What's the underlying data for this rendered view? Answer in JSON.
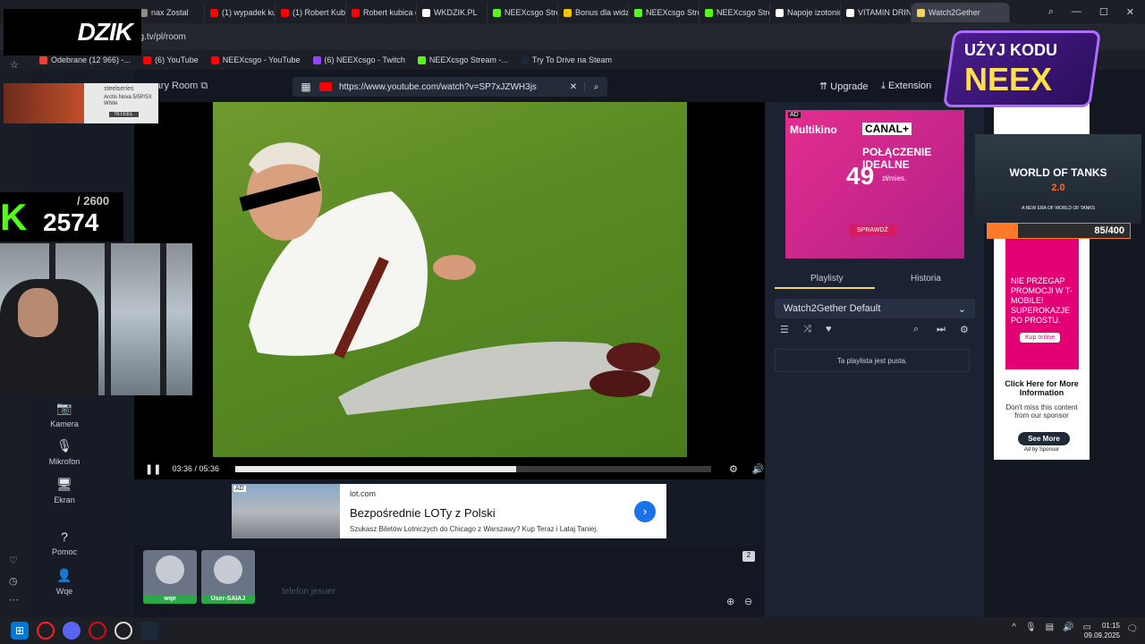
{
  "browser": {
    "tabs": [
      {
        "label": "nax Zostal",
        "color": "#8a8a8a"
      },
      {
        "label": "(1) wypadek kub",
        "color": "#ff0000"
      },
      {
        "label": "(1) Robert Kubic",
        "color": "#ff0000"
      },
      {
        "label": "Robert kubica cr",
        "color": "#ff0000"
      },
      {
        "label": "WKDZIK.PL",
        "color": "#ffffff"
      },
      {
        "label": "NEEXcsgo Stream",
        "color": "#53fc18"
      },
      {
        "label": "Bonus dla widzó",
        "color": "#f1c40f"
      },
      {
        "label": "NEEXcsgo Stream",
        "color": "#53fc18"
      },
      {
        "label": "NEEXcsgo Stream",
        "color": "#53fc18"
      },
      {
        "label": "Napoje izotonicz",
        "color": "#ffffff"
      },
      {
        "label": "VITAMIN DRINK",
        "color": "#ffffff"
      },
      {
        "label": "Watch2Gether",
        "color": "#f4d35e"
      }
    ],
    "url": "2g.tv/pl/room",
    "bookmarks": [
      {
        "label": "Odebrane (12 966) -...",
        "color": "#ea4335"
      },
      {
        "label": "(6) YouTube",
        "color": "#ff0000"
      },
      {
        "label": "NEEXcsgo - YouTube",
        "color": "#ff0000"
      },
      {
        "label": "(6) NEEXcsgo - Twitch",
        "color": "#9146ff"
      },
      {
        "label": "NEEXcsgo Stream -...",
        "color": "#53fc18"
      },
      {
        "label": "Try To Drive na Steam",
        "color": "#1b2838"
      }
    ]
  },
  "room": {
    "name": "rary Room",
    "search_value": "https://www.youtube.com/watch?v=SP7xJZWH3js",
    "upgrade": "Upgrade",
    "extension": "Extension"
  },
  "player": {
    "time": "03:36 / 05:36",
    "progress": 0.59
  },
  "rail": [
    {
      "label": "Kamera",
      "icon": "camera-icon",
      "glyph": "📷"
    },
    {
      "label": "Mikrofon",
      "icon": "mic-icon",
      "glyph": "🎙"
    },
    {
      "label": "Ekran",
      "icon": "screen-icon",
      "glyph": "🖥"
    },
    {
      "label": "Pomoc",
      "icon": "help-icon",
      "glyph": "?"
    },
    {
      "label": "Wqe",
      "icon": "user-icon",
      "glyph": "👤"
    }
  ],
  "ad_lot": {
    "domain": "lot.com",
    "title": "Bezpośrednie LOTy z Polski",
    "desc": "Szukasz Biletów Lotniczych do Chicago z Warszawy? Kup Teraz i Lataj Taniej.",
    "tag": "AD"
  },
  "users": [
    {
      "name": "wqe"
    },
    {
      "name": "User-SAIAJ"
    }
  ],
  "chat": {
    "count": "2",
    "placeholder": "telefon jesuer"
  },
  "ad_canal": {
    "tag": "AD",
    "brand1": "Multikino",
    "brand2": "CANAL+",
    "headline": "POŁĄCZENIE IDEALNE",
    "price": "49",
    "unit": "zł/mies.",
    "cta": "SPRAWDŹ"
  },
  "playlist": {
    "tab1": "Playlisty",
    "tab2": "Historia",
    "selected": "Watch2Gether Default",
    "empty": "Ta playlista jest pusta."
  },
  "ad_tmobile": {
    "text": "NIE PRZEGAP PROMOCJI W T-MOBILE! SUPEROKAZJE PO PROSTU.",
    "cta": "Kup online",
    "more_title": "Click Here for More Information",
    "more_desc": "Don't miss this content from our sponsor",
    "see_more": "See More",
    "by": "Ad by Sponsor"
  },
  "overlays": {
    "dzik": "DZIK",
    "steel_brand": "steelseries",
    "steel_product": "Arctis Nova 5/5P/5X White",
    "steel_code": "!STEEL",
    "score_value": "2574",
    "score_max": "/ 2600",
    "neex_line1": "UŻYJ KODU",
    "neex_line2": "NEEX",
    "wot_title": "WORLD OF TANKS",
    "wot_ver": "2.0",
    "wot_sub": "A NEW ERA OF WORLD OF TANKS",
    "goal": "85/400",
    "goal_fraction": 0.2125
  },
  "taskbar": {
    "time": "01:15",
    "date": "09.09.2025"
  }
}
